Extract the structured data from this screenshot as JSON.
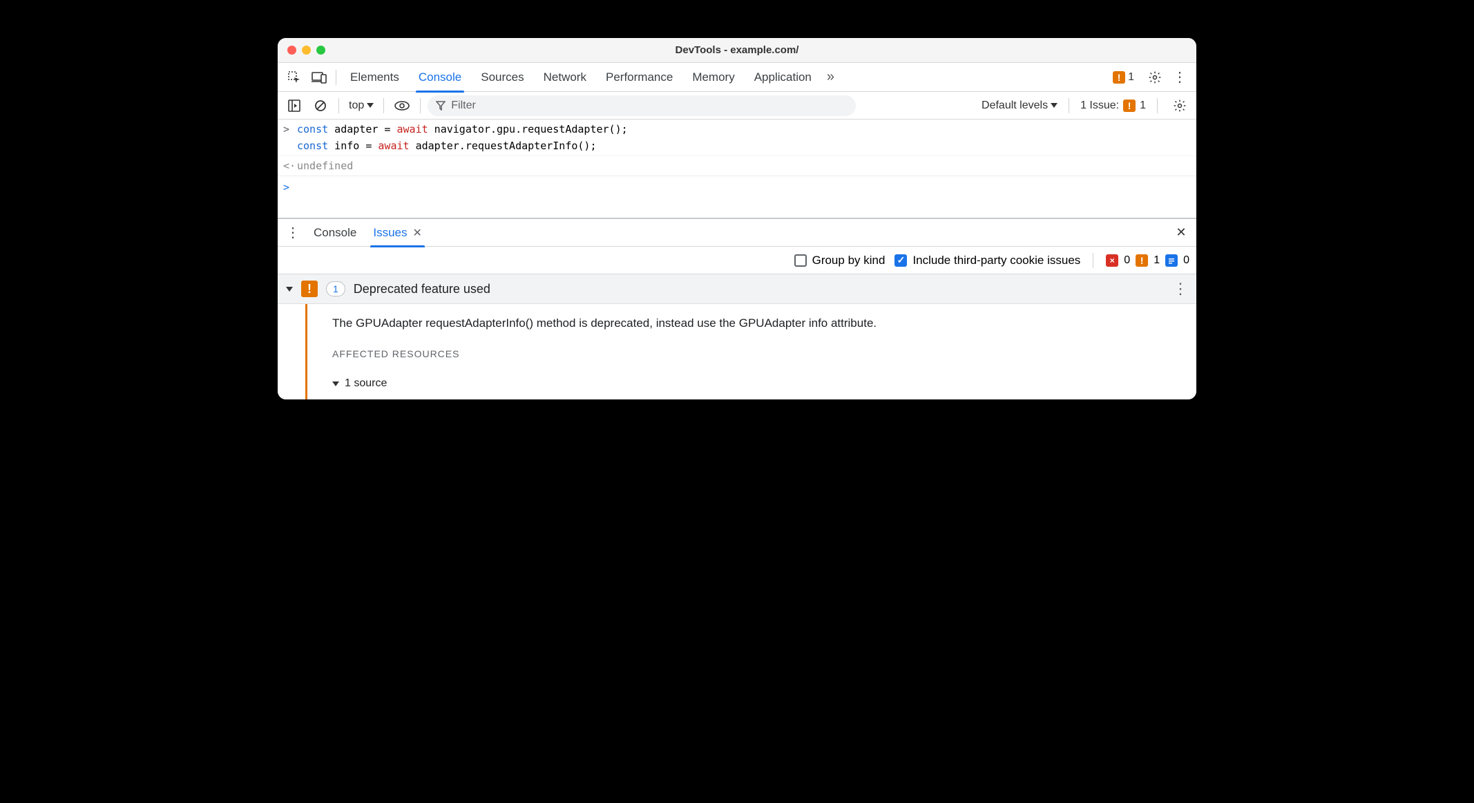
{
  "window": {
    "title": "DevTools - example.com/"
  },
  "tabs": {
    "items": [
      "Elements",
      "Console",
      "Sources",
      "Network",
      "Performance",
      "Memory",
      "Application"
    ],
    "active": "Console",
    "overflow_count": 1
  },
  "console_toolbar": {
    "context": "top",
    "filter_placeholder": "Filter",
    "levels": "Default levels",
    "issues_label": "1 Issue:",
    "issues_count": 1
  },
  "console": {
    "input_line1": "const adapter = await navigator.gpu.requestAdapter();",
    "input_line2": "const info = await adapter.requestAdapterInfo();",
    "output": "undefined"
  },
  "drawer": {
    "tabs": [
      "Console",
      "Issues"
    ],
    "active": "Issues",
    "group_by_kind_label": "Group by kind",
    "group_by_kind_checked": false,
    "include_tp_label": "Include third-party cookie issues",
    "include_tp_checked": true,
    "counts": {
      "errors": 0,
      "warnings": 1,
      "info": 0
    }
  },
  "issue": {
    "count": 1,
    "title": "Deprecated feature used",
    "description": "The GPUAdapter requestAdapterInfo() method is deprecated, instead use the GPUAdapter info attribute.",
    "affected_label": "Affected Resources",
    "source_label": "1 source"
  }
}
